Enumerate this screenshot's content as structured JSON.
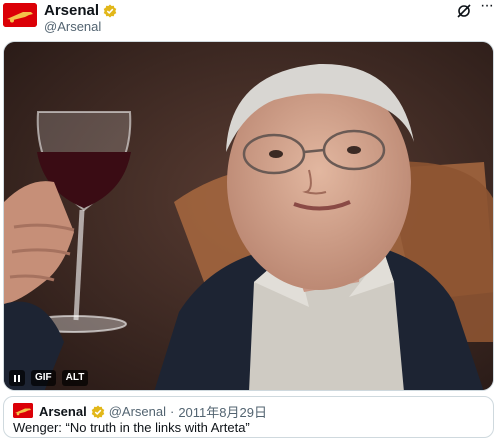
{
  "post": {
    "author": {
      "display_name": "Arsenal",
      "handle": "@Arsenal",
      "verified": true,
      "avatar_color": "#db0007"
    },
    "actions": {
      "grok_icon": "grok-icon",
      "more_icon": "more-icon",
      "more_glyph": "···"
    }
  },
  "media": {
    "kind": "gif",
    "controls": {
      "pause_icon": "pause-icon",
      "gif_label": "GIF",
      "alt_label": "ALT"
    }
  },
  "quote": {
    "author": {
      "display_name": "Arsenal",
      "handle": "@Arsenal",
      "verified": true
    },
    "separator": "·",
    "date": "2011年8月29日",
    "text": "Wenger: “No truth in the links with Arteta”"
  },
  "colors": {
    "accent_red": "#db0007",
    "verified_gold": "#e2b719",
    "text_secondary": "#536471",
    "border": "#cfd9de"
  }
}
